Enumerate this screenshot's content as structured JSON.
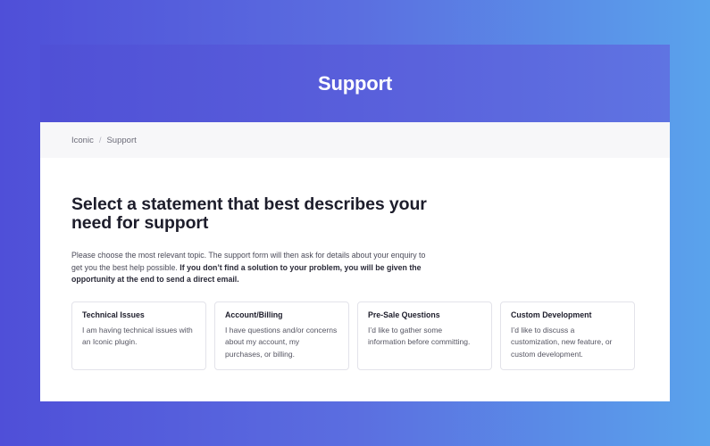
{
  "hero": {
    "title": "Support"
  },
  "breadcrumb": {
    "home": "Iconic",
    "separator": "/",
    "current": "Support"
  },
  "main": {
    "heading": "Select a statement that best describes your need for support",
    "intro_text": "Please choose the most relevant topic. The support form will then ask for details about your enquiry to get you the best help possible.",
    "intro_bold": "If you don’t find a solution to your problem, you will be given the opportunity at the end to send a direct email."
  },
  "cards": [
    {
      "title": "Technical Issues",
      "description": "I am having technical issues with an Iconic plugin."
    },
    {
      "title": "Account/Billing",
      "description": "I have questions and/or concerns about my account, my purchases, or billing."
    },
    {
      "title": "Pre-Sale Questions",
      "description": "I’d like to gather some information before committing."
    },
    {
      "title": "Custom Development",
      "description": "I’d like to discuss a customization, new feature, or custom development."
    }
  ]
}
